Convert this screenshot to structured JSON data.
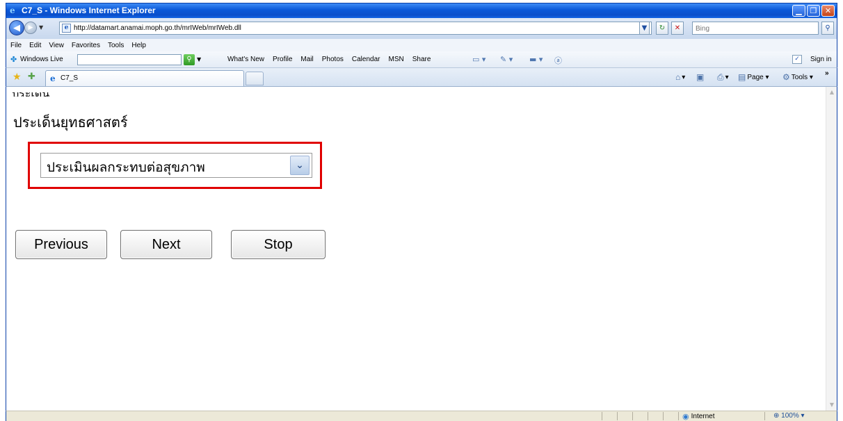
{
  "window": {
    "title": "C7_S - Windows Internet Explorer",
    "minimize_glyph": "▁",
    "maximize_glyph": "❐",
    "close_glyph": "✕"
  },
  "address_bar": {
    "url": "http://datamart.anamai.moph.go.th/mrIWeb/mrIWeb.dll",
    "search_placeholder": "Bing"
  },
  "menu": [
    "File",
    "Edit",
    "View",
    "Favorites",
    "Tools",
    "Help"
  ],
  "links_bar": {
    "windows_live_label": "Windows Live",
    "links": [
      "What's New",
      "Profile",
      "Mail",
      "Photos",
      "Calendar",
      "MSN",
      "Share"
    ],
    "sign_in": "Sign in"
  },
  "tab_bar": {
    "active_tab": "C7_S",
    "page_label": "Page",
    "tools_label": "Tools"
  },
  "page": {
    "heading": "ประเด็นยุทธศาสตร์",
    "select_value": "ประเมินผลกระทบต่อสุขภาพ",
    "buttons": {
      "previous": "Previous",
      "next": "Next",
      "stop": "Stop"
    }
  },
  "status_bar": {
    "zone": "Internet",
    "zoom": "100%"
  },
  "icons": {
    "back": "back-arrow-icon",
    "forward": "forward-arrow-icon",
    "refresh": "refresh-icon",
    "stop": "stop-icon",
    "search": "search-icon",
    "favorites": "favorites-star-icon",
    "home": "home-icon",
    "print": "print-icon",
    "globe": "globe-icon"
  },
  "colors": {
    "titlebar_blue": "#0a58d8",
    "highlight_red": "#e00000",
    "statusbar": "#ece9d8"
  }
}
